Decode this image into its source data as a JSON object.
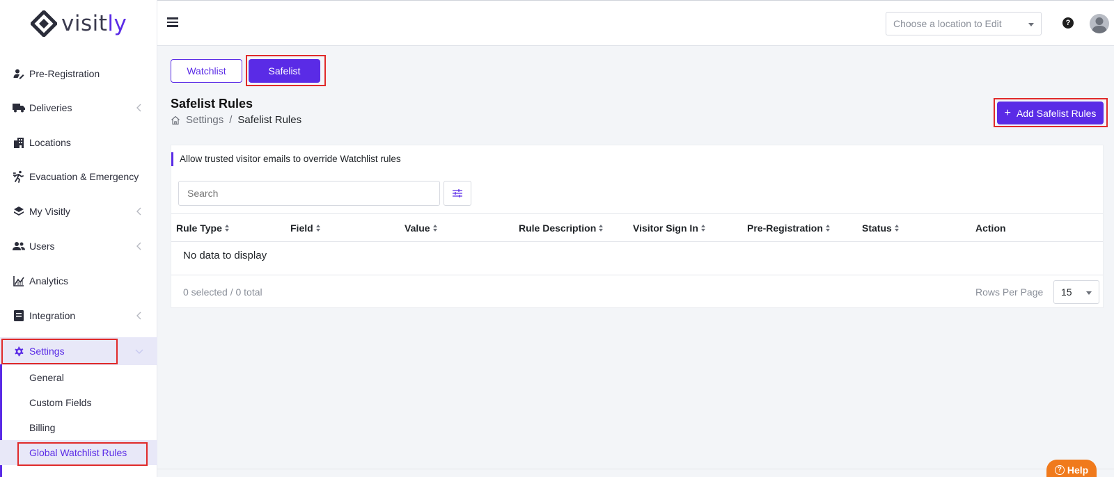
{
  "brand": {
    "logo_prefix": "visit",
    "logo_suffix": "ly",
    "accent": "#5a2be6"
  },
  "sidebar": {
    "items": [
      {
        "label": "Pre-Registration",
        "icon": "user-pen-icon"
      },
      {
        "label": "Deliveries",
        "icon": "truck-icon"
      },
      {
        "label": "Locations",
        "icon": "building-icon"
      },
      {
        "label": "Evacuation & Emergency",
        "icon": "running-person-icon"
      },
      {
        "label": "My Visitly",
        "icon": "layers-icon"
      },
      {
        "label": "Users",
        "icon": "users-icon"
      },
      {
        "label": "Analytics",
        "icon": "chart-line-icon"
      },
      {
        "label": "Integration",
        "icon": "integration-icon"
      },
      {
        "label": "Settings",
        "icon": "gear-icon"
      }
    ],
    "settings_sub": [
      "General",
      "Custom Fields",
      "Billing",
      "Global Watchlist Rules"
    ]
  },
  "header": {
    "location_placeholder": "Choose a location to Edit",
    "help_glyph": "?"
  },
  "tabs": {
    "watchlist": "Watchlist",
    "safelist": "Safelist"
  },
  "page": {
    "title": "Safelist Rules",
    "breadcrumb": [
      "Settings",
      "Safelist Rules"
    ],
    "breadcrumb_sep": "/",
    "add_button": "Add Safelist Rules",
    "add_plus": "+"
  },
  "card": {
    "info": "Allow trusted visitor emails to override Watchlist rules",
    "search_placeholder": "Search",
    "columns": [
      "Rule Type",
      "Field",
      "Value",
      "Rule Description",
      "Visitor Sign In",
      "Pre-Registration",
      "Status",
      "Action"
    ],
    "empty": "No data to display",
    "selection": "0 selected / 0 total",
    "rows_per_page_label": "Rows Per Page",
    "rows_per_page": "15"
  },
  "help_widget": {
    "label": "Help",
    "glyph": "?"
  }
}
